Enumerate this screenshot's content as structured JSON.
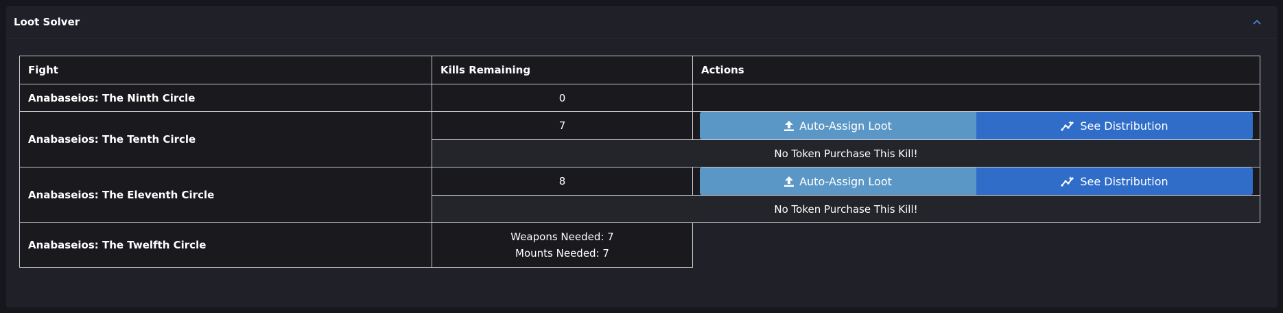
{
  "panel": {
    "title": "Loot Solver"
  },
  "table": {
    "headers": [
      "Fight",
      "Kills Remaining",
      "Actions"
    ],
    "rows": [
      {
        "fight": "Anabaseios: The Ninth Circle",
        "kills": "0"
      },
      {
        "fight": "Anabaseios: The Tenth Circle",
        "kills": "7",
        "auto_assign_label": "Auto-Assign Loot",
        "see_distribution_label": "See Distribution",
        "note": "No Token Purchase This Kill!"
      },
      {
        "fight": "Anabaseios: The Eleventh Circle",
        "kills": "8",
        "auto_assign_label": "Auto-Assign Loot",
        "see_distribution_label": "See Distribution",
        "note": "No Token Purchase This Kill!"
      },
      {
        "fight": "Anabaseios: The Twelfth Circle",
        "weapons_needed": "Weapons Needed: 7",
        "mounts_needed": "Mounts Needed: 7"
      }
    ]
  },
  "icons": {
    "collapse": "chevron-up-icon",
    "auto_assign": "upload-icon",
    "see_distribution": "chart-line-icon"
  },
  "colors": {
    "accent": "#2f6dc9",
    "auto_assign_button": "#5b97c6",
    "see_distribution_button": "#2f6dc9"
  }
}
